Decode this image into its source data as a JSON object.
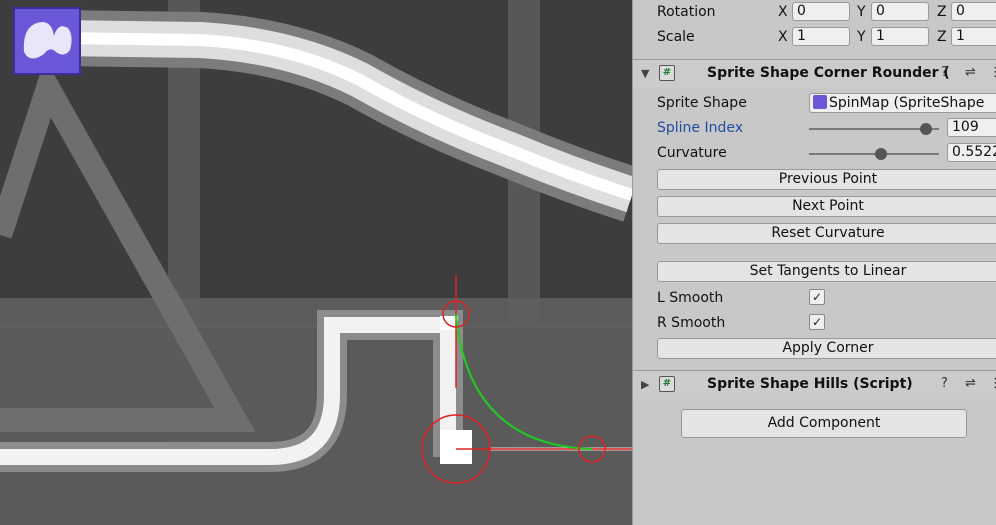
{
  "transform": {
    "rotation_label": "Rotation",
    "scale_label": "Scale",
    "axis_x": "X",
    "axis_y": "Y",
    "axis_z": "Z",
    "rotation": {
      "x": "0",
      "y": "0",
      "z": "0"
    },
    "scale": {
      "x": "1",
      "y": "1",
      "z": "1"
    }
  },
  "corner_rounder": {
    "title": "Sprite Shape Corner Rounder (",
    "hash_glyph": "#",
    "sprite_shape_label": "Sprite Shape",
    "sprite_shape_value": "SpinMap  (SpriteShape",
    "spline_index_label": "Spline Index",
    "spline_index_value": "109",
    "spline_index_fraction": 0.9,
    "curvature_label": "Curvature",
    "curvature_value": "0.5522",
    "curvature_fraction": 0.55,
    "previous_point": "Previous Point",
    "next_point": "Next Point",
    "reset_curvature": "Reset Curvature",
    "set_tangents": "Set Tangents to Linear",
    "l_smooth_label": "L Smooth",
    "r_smooth_label": "R Smooth",
    "check_glyph": "✓",
    "apply_corner": "Apply Corner"
  },
  "hills": {
    "title": "Sprite Shape Hills (Script)",
    "hash_glyph": "#"
  },
  "add_component": "Add Component",
  "icons": {
    "help": "?",
    "settings": "⇌",
    "more": "⋮",
    "collapse": "▼",
    "expand": "▶"
  },
  "colors": {
    "accent_label": "#1f4fa0",
    "spline_green": "#22cc22",
    "handle_red": "#dd2222",
    "sprite_purple": "#6a58d8"
  }
}
